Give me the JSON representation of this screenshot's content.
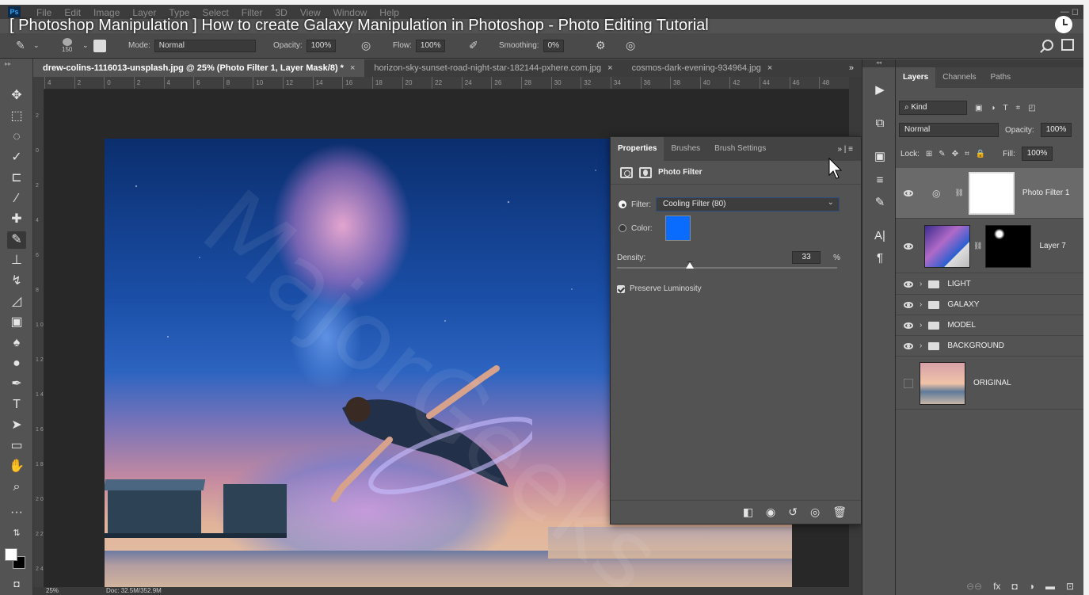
{
  "video": {
    "title": "[ Photoshop Manipulation ] How to create Galaxy Manipulation in Photoshop - Photo Editing Tutorial"
  },
  "menu": {
    "logo": "Ps",
    "items": [
      "File",
      "Edit",
      "Image",
      "Layer",
      "Type",
      "Select",
      "Filter",
      "3D",
      "View",
      "Window",
      "Help"
    ]
  },
  "options": {
    "brush_size": "150",
    "mode_label": "Mode:",
    "mode_value": "Normal",
    "opacity_label": "Opacity:",
    "opacity_value": "100%",
    "flow_label": "Flow:",
    "flow_value": "100%",
    "smoothing_label": "Smoothing:",
    "smoothing_value": "0%"
  },
  "tabs": [
    {
      "label": "drew-colins-1116013-unsplash.jpg @ 25% (Photo Filter 1, Layer Mask/8) *",
      "close": "×"
    },
    {
      "label": "horizon-sky-sunset-road-night-star-182144-pxhere.com.jpg",
      "close": "×"
    },
    {
      "label": "cosmos-dark-evening-934964.jpg",
      "close": "×"
    }
  ],
  "tabs_more": "»",
  "ruler_h": [
    "4",
    "2",
    "0",
    "2",
    "4",
    "6",
    "8",
    "10",
    "12",
    "14",
    "16",
    "18",
    "20",
    "22",
    "24",
    "26",
    "28",
    "30",
    "32",
    "34",
    "36",
    "38",
    "40",
    "42",
    "44",
    "46",
    "48"
  ],
  "ruler_v": [
    "2",
    "0",
    "2",
    "4",
    "6",
    "8",
    "1 0",
    "1 2",
    "1 4",
    "1 6",
    "1 8",
    "2 0",
    "2 2",
    "2 4"
  ],
  "properties": {
    "tabs": [
      "Properties",
      "Brushes",
      "Brush Settings"
    ],
    "menu_glyph": "» | ≡",
    "title": "Photo Filter",
    "filter_label": "Filter:",
    "filter_value": "Cooling Filter (80)",
    "color_label": "Color:",
    "color_hex": "#0a6cff",
    "density_label": "Density:",
    "density_value": "33",
    "density_unit": "%",
    "density_fraction": 0.33,
    "preserve_label": "Preserve Luminosity",
    "preserve_checked": true
  },
  "layers": {
    "tabs": [
      "Layers",
      "Channels",
      "Paths"
    ],
    "kind_label": "Kind",
    "blend_mode": "Normal",
    "opacity_label": "Opacity:",
    "opacity_value": "100%",
    "lock_label": "Lock:",
    "fill_label": "Fill:",
    "fill_value": "100%",
    "items": [
      {
        "name": "Photo Filter 1",
        "type": "adjustment",
        "visible": true,
        "selected": true
      },
      {
        "name": "Layer 7",
        "type": "pixel",
        "visible": true,
        "selected": false
      },
      {
        "name": "LIGHT",
        "type": "group",
        "visible": true,
        "selected": false
      },
      {
        "name": "GALAXY",
        "type": "group",
        "visible": true,
        "selected": false
      },
      {
        "name": "MODEL",
        "type": "group",
        "visible": true,
        "selected": false
      },
      {
        "name": "BACKGROUND",
        "type": "group",
        "visible": true,
        "selected": false
      },
      {
        "name": "ORIGINAL",
        "type": "pixel",
        "visible": false,
        "selected": false
      }
    ]
  },
  "status": {
    "zoom": "25%",
    "doc": "Doc: 32.5M/352.9M"
  },
  "watermark": "MajorGeeks",
  "colors": {
    "accent": "#2c4e80",
    "swatch": "#0a6cff",
    "panel_bg": "#535353",
    "dark_bg": "#282828"
  }
}
